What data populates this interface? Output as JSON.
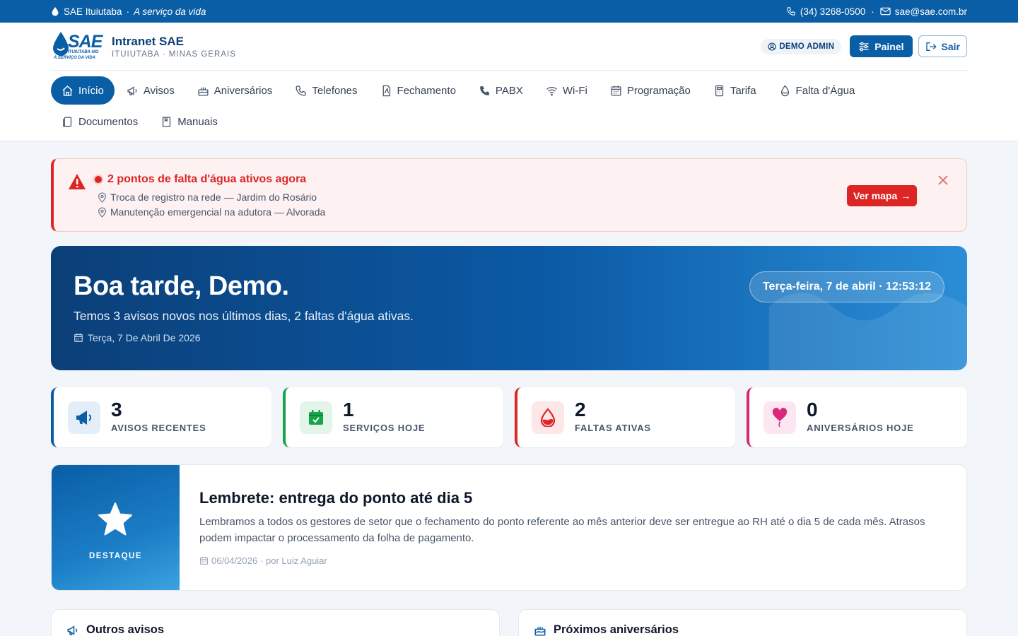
{
  "topbar": {
    "org": "SAE Ituiutaba",
    "separator": "·",
    "tagline": "A serviço da vida",
    "phone": "(34) 3268-0500",
    "email": "sae@sae.com.br"
  },
  "brand": {
    "logo_word": "SAE",
    "logo_sub": "ITUIUTABA-MG",
    "logo_sub2": "A SERVIÇO DA VIDA",
    "title": "Intranet SAE",
    "subtitle": "ITUIUTABA · MINAS GERAIS"
  },
  "header_actions": {
    "user": "DEMO ADMIN",
    "painel": "Painel",
    "sair": "Sair"
  },
  "nav": {
    "items": [
      {
        "label": "Início",
        "icon": "home-icon"
      },
      {
        "label": "Avisos",
        "icon": "megaphone-icon"
      },
      {
        "label": "Aniversários",
        "icon": "cake-icon"
      },
      {
        "label": "Telefones",
        "icon": "phone-icon"
      },
      {
        "label": "Fechamento",
        "icon": "document-icon"
      },
      {
        "label": "PABX",
        "icon": "phone-filled-icon"
      },
      {
        "label": "Wi-Fi",
        "icon": "wifi-icon"
      },
      {
        "label": "Programação",
        "icon": "calendar-icon"
      },
      {
        "label": "Tarifa",
        "icon": "calculator-icon"
      },
      {
        "label": "Falta d'Água",
        "icon": "water-drop-icon"
      },
      {
        "label": "Documentos",
        "icon": "files-icon"
      },
      {
        "label": "Manuais",
        "icon": "book-icon"
      }
    ],
    "active_index": 0
  },
  "alert": {
    "title": "2 pontos de falta d'água ativos agora",
    "points": [
      "Troca de registro na rede — Jardim do Rosário",
      "Manutenção emergencial na adutora — Alvorada"
    ],
    "button": "Ver mapa",
    "button_arrow": "→"
  },
  "hero": {
    "greeting": "Boa tarde, Demo.",
    "summary": "Temos 3 avisos novos nos últimos dias, 2 faltas d'água ativas.",
    "date": "Terça, 7 De Abril De 2026",
    "clock": "Terça-feira, 7 de abril · 12:53:12"
  },
  "stats": [
    {
      "value": "3",
      "label": "AVISOS RECENTES",
      "color": "#0a5ea6",
      "bg": "#e4eef8",
      "icon": "megaphone-icon"
    },
    {
      "value": "1",
      "label": "SERVIÇOS HOJE",
      "color": "#16a34a",
      "bg": "#e3f5e9",
      "icon": "calendar-check-icon"
    },
    {
      "value": "2",
      "label": "FALTAS ATIVAS",
      "color": "#dc2626",
      "bg": "#fde7e7",
      "icon": "water-drop-icon"
    },
    {
      "value": "0",
      "label": "ANIVERSÁRIOS HOJE",
      "color": "#db2777",
      "bg": "#fce7f1",
      "icon": "balloon-icon"
    }
  ],
  "featured": {
    "tag": "DESTAQUE",
    "title": "Lembrete: entrega do ponto até dia 5",
    "body": "Lembramos a todos os gestores de setor que o fechamento do ponto referente ao mês anterior deve ser entregue ao RH até o dia 5 de cada mês. Atrasos podem impactar o processamento da folha de pagamento.",
    "date": "06/04/2026",
    "author": "· por Luiz Aguiar"
  },
  "cards": {
    "outros_avisos": "Outros avisos",
    "proximos_aniversarios": "Próximos aniversários"
  },
  "colors": {
    "primary": "#0a5ea6",
    "danger": "#dc2626",
    "success": "#16a34a",
    "pink": "#db2777"
  }
}
